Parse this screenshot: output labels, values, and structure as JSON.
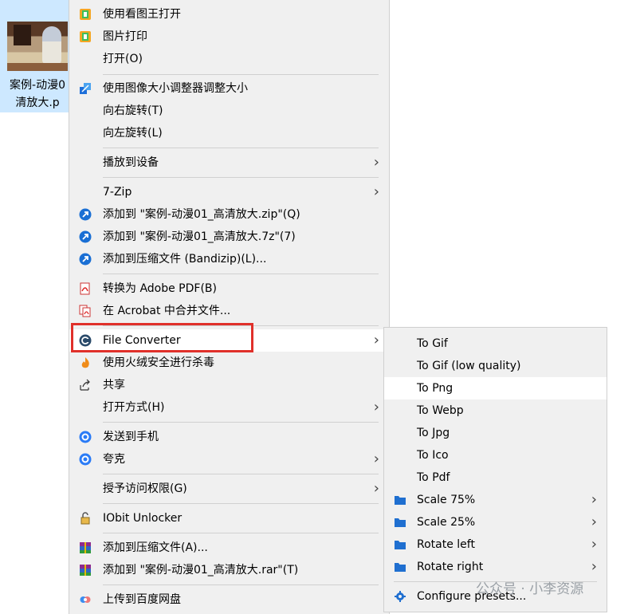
{
  "desktop_file": {
    "label_line1": "案例-动漫0",
    "label_line2": "清放大.p"
  },
  "menu": {
    "items": [
      {
        "label": "使用看图王打开",
        "icon": "kantu-app-icon"
      },
      {
        "label": "图片打印",
        "icon": "kantu-app-icon"
      },
      {
        "label": "打开(O)"
      },
      {
        "label": "使用图像大小调整器调整大小",
        "icon": "image-resizer-icon"
      },
      {
        "label": "向右旋转(T)"
      },
      {
        "label": "向左旋转(L)"
      },
      {
        "label": "播放到设备"
      },
      {
        "label": "7-Zip"
      },
      {
        "label": "添加到 \"案例-动漫01_高清放大.zip\"(Q)",
        "icon": "bandizip-icon"
      },
      {
        "label": "添加到 \"案例-动漫01_高清放大.7z\"(7)",
        "icon": "bandizip-icon"
      },
      {
        "label": "添加到压缩文件 (Bandizip)(L)...",
        "icon": "bandizip-icon"
      },
      {
        "label": "转换为 Adobe PDF(B)",
        "icon": "adobe-pdf-icon"
      },
      {
        "label": "在 Acrobat 中合并文件...",
        "icon": "acrobat-combine-icon"
      },
      {
        "label": "File Converter",
        "icon": "file-converter-icon"
      },
      {
        "label": "使用火绒安全进行杀毒",
        "icon": "huorong-icon"
      },
      {
        "label": "共享",
        "icon": "share-icon"
      },
      {
        "label": "打开方式(H)"
      },
      {
        "label": "发送到手机",
        "icon": "phone-send-icon"
      },
      {
        "label": "夸克",
        "icon": "quark-icon"
      },
      {
        "label": "授予访问权限(G)"
      },
      {
        "label": "IObit Unlocker",
        "icon": "iobit-lock-icon"
      },
      {
        "label": "添加到压缩文件(A)...",
        "icon": "winrar-icon"
      },
      {
        "label": "添加到 \"案例-动漫01_高清放大.rar\"(T)",
        "icon": "winrar-icon"
      },
      {
        "label": "上传到百度网盘",
        "icon": "baidu-netdisk-icon"
      }
    ]
  },
  "submenu": {
    "items": [
      {
        "label": "To Gif"
      },
      {
        "label": "To Gif (low quality)"
      },
      {
        "label": "To Png"
      },
      {
        "label": "To Webp"
      },
      {
        "label": "To Jpg"
      },
      {
        "label": "To Ico"
      },
      {
        "label": "To Pdf"
      },
      {
        "label": "Scale 75%",
        "icon": "folder-icon"
      },
      {
        "label": "Scale 25%",
        "icon": "folder-icon"
      },
      {
        "label": "Rotate left",
        "icon": "folder-icon"
      },
      {
        "label": "Rotate right",
        "icon": "folder-icon"
      },
      {
        "label": "Configure presets...",
        "icon": "gear-icon"
      }
    ]
  },
  "watermark": "公众号 · 小李资源",
  "colors": {
    "highlight_box": "#e0302a",
    "selection": "#cde8ff",
    "menu_bg": "#f0f0f0"
  }
}
